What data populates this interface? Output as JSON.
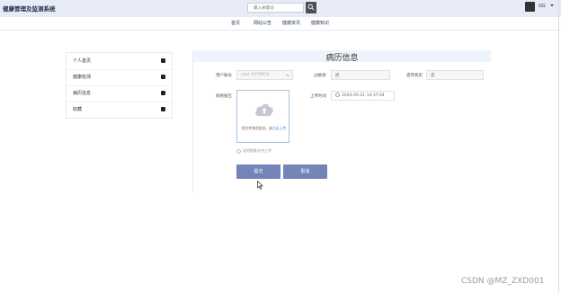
{
  "header": {
    "app_title": "健康管理及监测系统",
    "search_placeholder": "输入关键词",
    "user_name": "GG"
  },
  "nav": {
    "items": [
      "首页",
      "网站公告",
      "健康资讯",
      "健康知识"
    ]
  },
  "sidebar": {
    "items": [
      "个人首页",
      "健康检测",
      "病历信息",
      "收藏"
    ]
  },
  "form": {
    "title": "病历信息",
    "account_label": "用户账号",
    "account_value": "user 1076974",
    "allergy_label": "过敏源",
    "allergy_placeholder": "原",
    "genetic_label": "遗传病史",
    "genetic_placeholder": "遗",
    "report_label": "病例报告",
    "upload_time_label": "上传时间",
    "upload_time_value": "2024-05-21 14:37:04",
    "upload_hint_text": "将文件拖到此处，或",
    "upload_hint_link": "点击上传",
    "tip": "说明图像支持上传",
    "submit_label": "提交",
    "cancel_label": "取消"
  },
  "watermark": "CSDN @MZ_ZXD001"
}
